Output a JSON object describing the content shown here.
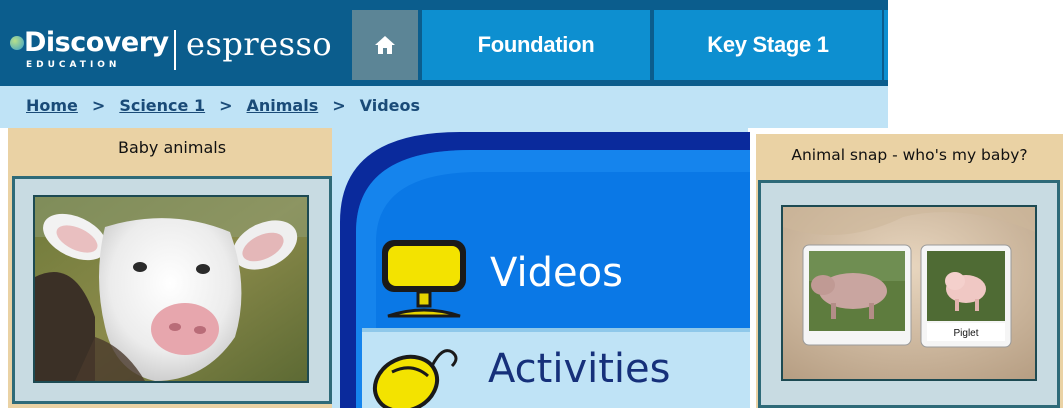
{
  "header": {
    "logo_brand": "DISCOVERY",
    "logo_brand_display": "Discovery",
    "logo_sub": "EDUCATION",
    "logo_product": "espresso",
    "nav": [
      {
        "label": "Foundation"
      },
      {
        "label": "Key Stage 1"
      }
    ],
    "home_icon": "home-icon",
    "colors": {
      "header_bg": "#0b5d8d",
      "nav_bg": "#0d8fd0",
      "home_bg": "#5c8596"
    }
  },
  "breadcrumb": {
    "items": [
      {
        "label": "Home",
        "link": true
      },
      {
        "label": "Science 1",
        "link": true
      },
      {
        "label": "Animals",
        "link": true
      },
      {
        "label": "Videos",
        "link": false
      }
    ],
    "separator": ">"
  },
  "cards": {
    "left": {
      "title": "Baby animals",
      "image": "white calf photo"
    },
    "right": {
      "title": "Animal snap - who's my baby?",
      "image": "pig and piglet cards",
      "card_label": "Piglet"
    }
  },
  "menu": {
    "items": [
      {
        "label": "Videos",
        "icon": "monitor-icon"
      },
      {
        "label": "Activities",
        "icon": "mouse-icon"
      }
    ]
  }
}
